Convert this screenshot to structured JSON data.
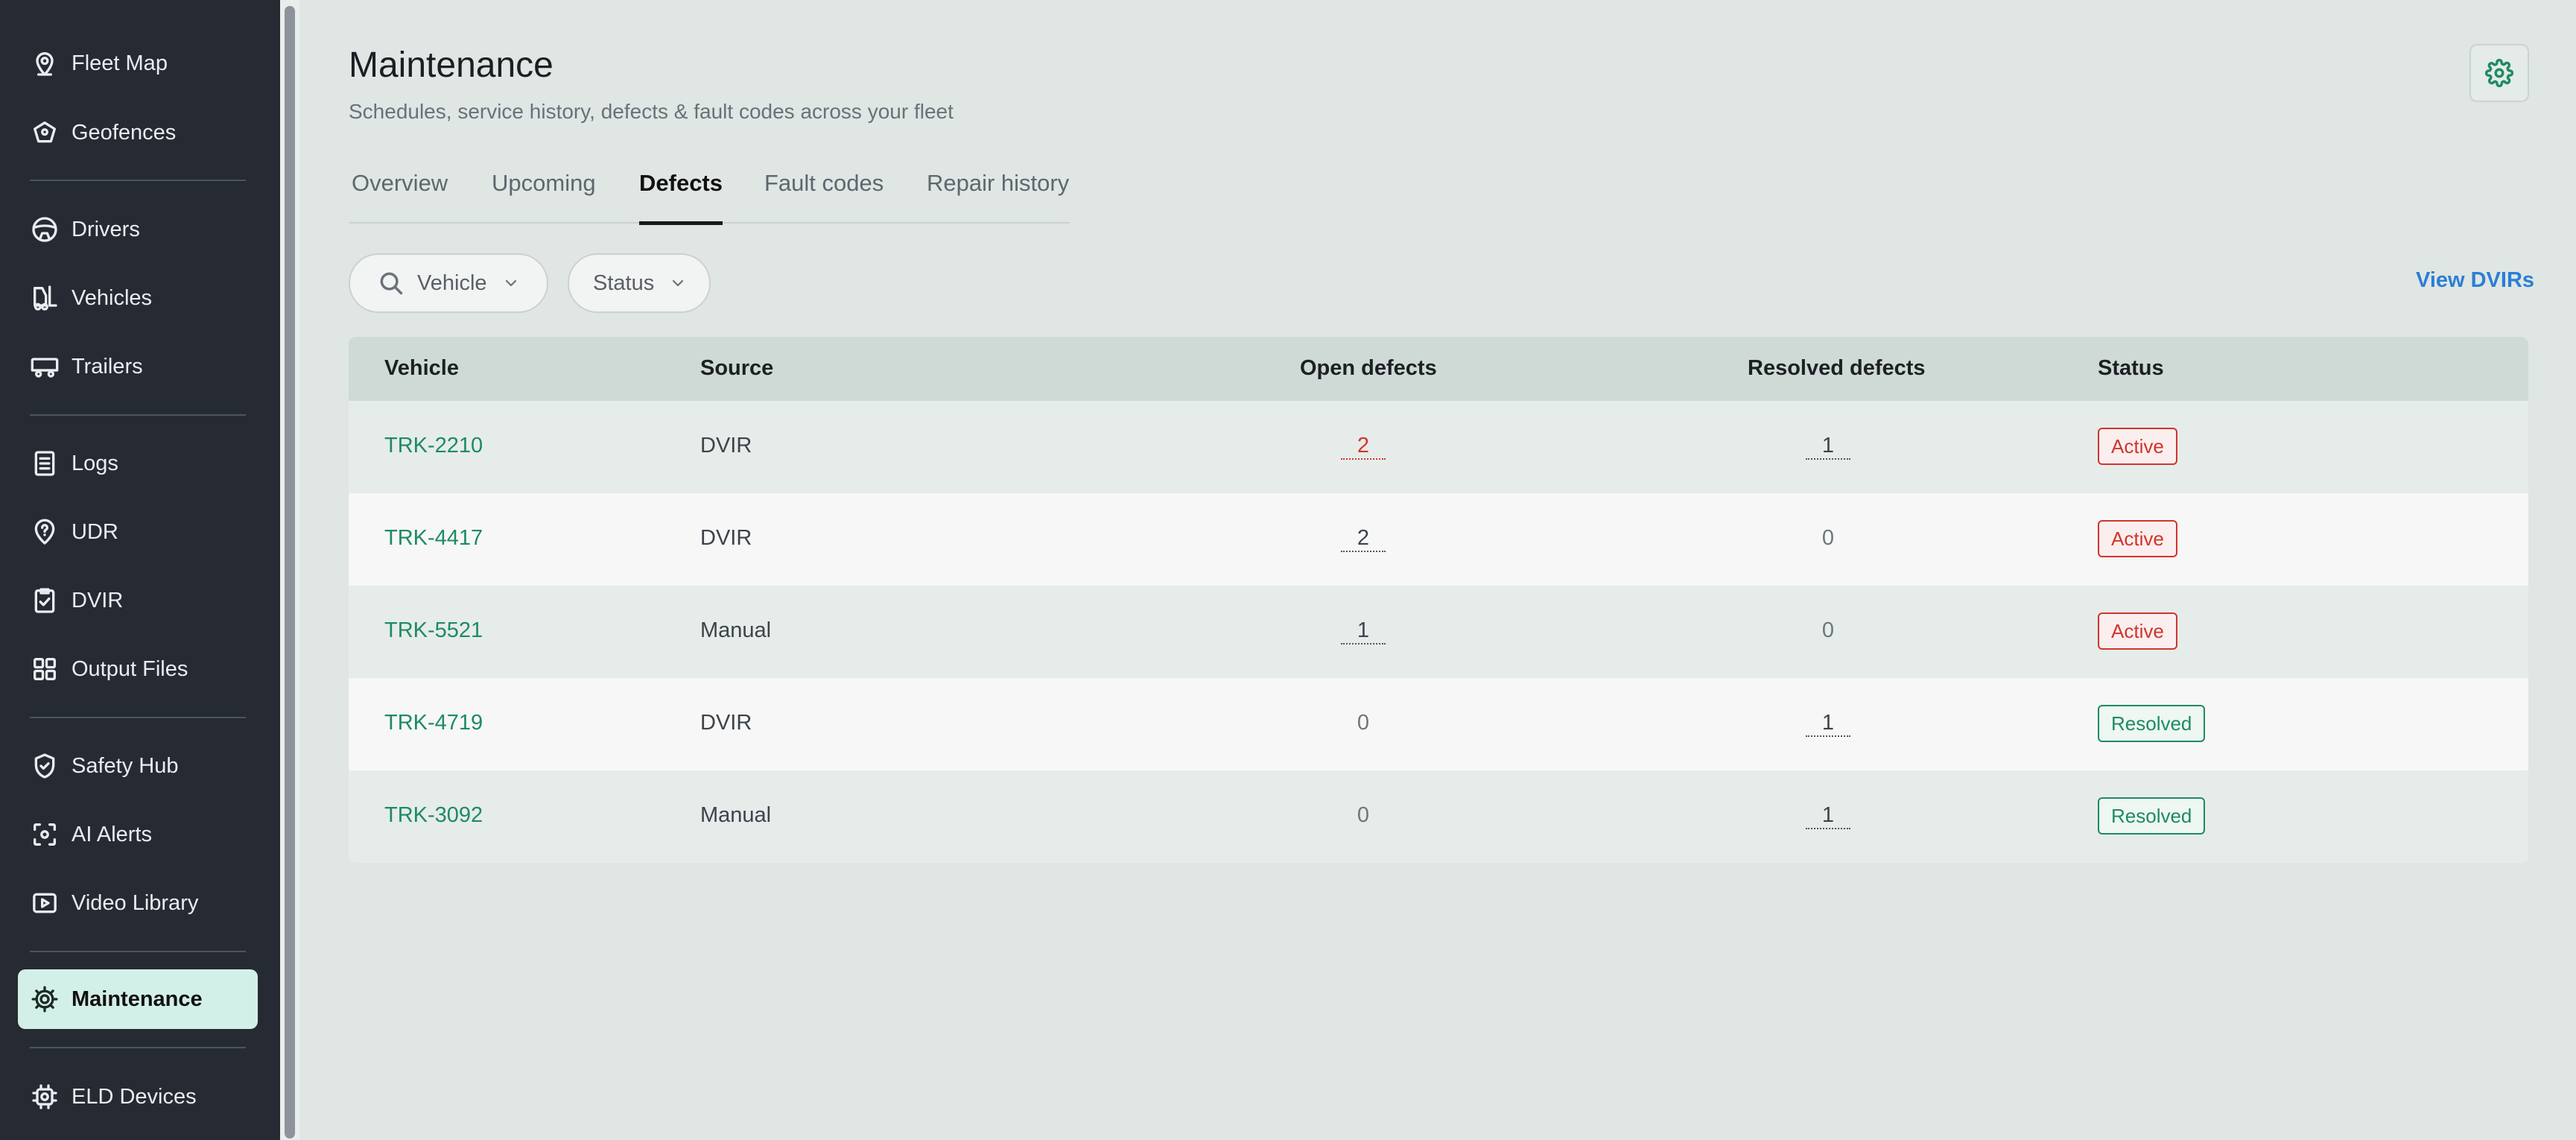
{
  "sidebar": {
    "items": [
      {
        "label": "Fleet Map",
        "icon": "map-pin-icon"
      },
      {
        "label": "Geofences",
        "icon": "geofence-icon"
      },
      {
        "label": "Drivers",
        "icon": "steering-wheel-icon"
      },
      {
        "label": "Vehicles",
        "icon": "forklift-icon"
      },
      {
        "label": "Trailers",
        "icon": "trailer-icon"
      },
      {
        "label": "Logs",
        "icon": "clipboard-icon"
      },
      {
        "label": "UDR",
        "icon": "question-pin-icon"
      },
      {
        "label": "DVIR",
        "icon": "clipboard-check-icon"
      },
      {
        "label": "Output Files",
        "icon": "grid-icon"
      },
      {
        "label": "Safety Hub",
        "icon": "shield-check-icon"
      },
      {
        "label": "AI Alerts",
        "icon": "scan-icon"
      },
      {
        "label": "Video Library",
        "icon": "play-icon"
      },
      {
        "label": "Maintenance",
        "icon": "cog-icon",
        "active": true
      },
      {
        "label": "ELD Devices",
        "icon": "chip-icon"
      }
    ]
  },
  "header": {
    "title": "Maintenance",
    "subtitle": "Schedules, service history, defects & fault codes across your fleet"
  },
  "tabs": [
    {
      "label": "Overview"
    },
    {
      "label": "Upcoming"
    },
    {
      "label": "Defects",
      "active": true
    },
    {
      "label": "Fault codes"
    },
    {
      "label": "Repair history"
    }
  ],
  "filters": {
    "vehicle_label": "Vehicle",
    "status_label": "Status",
    "view_link": "View DVIRs"
  },
  "table": {
    "columns": [
      "Vehicle",
      "Source",
      "Open defects",
      "Resolved defects",
      "Status"
    ],
    "rows": [
      {
        "vehicle": "TRK-2210",
        "source": "DVIR",
        "open": "2",
        "resolved": "1",
        "status": "Active"
      },
      {
        "vehicle": "TRK-4417",
        "source": "DVIR",
        "open": "2",
        "resolved": "0",
        "status": "Active"
      },
      {
        "vehicle": "TRK-5521",
        "source": "Manual",
        "open": "1",
        "resolved": "0",
        "status": "Active"
      },
      {
        "vehicle": "TRK-4719",
        "source": "DVIR",
        "open": "0",
        "resolved": "1",
        "status": "Resolved"
      },
      {
        "vehicle": "TRK-3092",
        "source": "Manual",
        "open": "0",
        "resolved": "1",
        "status": "Resolved"
      }
    ]
  },
  "colors": {
    "sidebar_bg": "#262b33",
    "active_nav_bg": "#d3f0e8",
    "accent_green": "#1e8b62",
    "alert_red": "#d0352b",
    "link_blue": "#2a7fd4"
  }
}
